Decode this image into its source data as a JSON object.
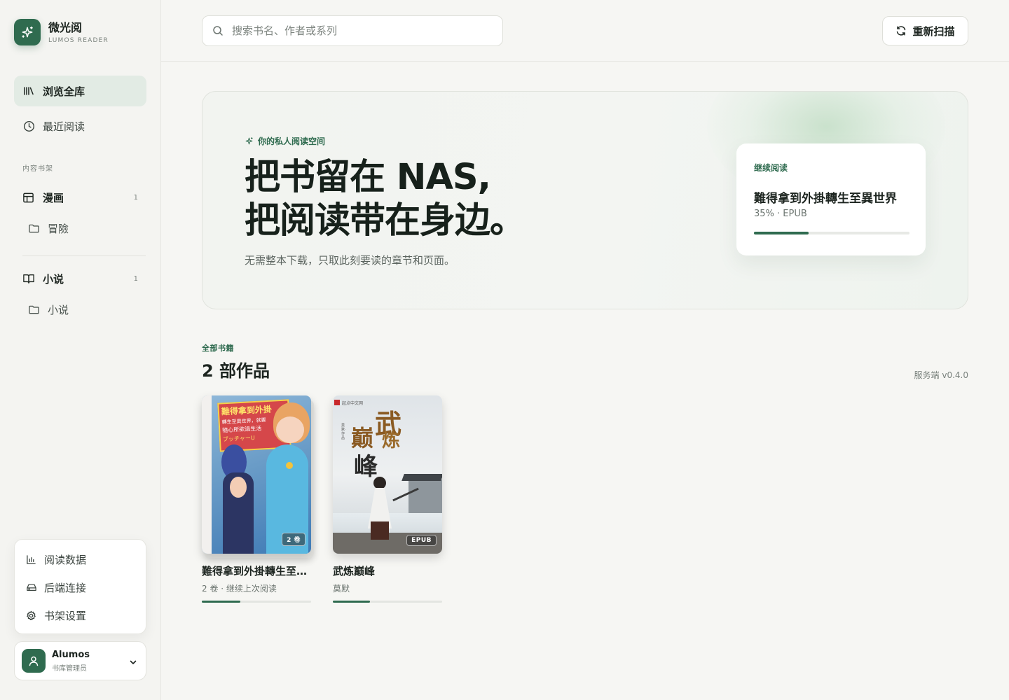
{
  "brand": {
    "title": "微光阅",
    "subtitle": "LUMOS READER"
  },
  "nav": [
    {
      "label": "浏览全库",
      "icon": "library-icon",
      "active": true
    },
    {
      "label": "最近阅读",
      "icon": "clock-icon",
      "active": false
    }
  ],
  "sidebar_section_label": "内容书架",
  "shelves": [
    {
      "label": "漫画",
      "count": "1",
      "icon": "layout-icon",
      "folders": [
        {
          "label": "冒險"
        }
      ]
    },
    {
      "label": "小说",
      "count": "1",
      "icon": "book-open-icon",
      "folders": [
        {
          "label": "小说"
        }
      ]
    }
  ],
  "menu": [
    {
      "label": "阅读数据",
      "icon": "bar-chart-icon"
    },
    {
      "label": "后端连接",
      "icon": "hard-drive-icon"
    },
    {
      "label": "书架设置",
      "icon": "gear-icon"
    }
  ],
  "user": {
    "name": "Alumos",
    "role": "书库管理员"
  },
  "search": {
    "placeholder": "搜索书名、作者或系列",
    "value": ""
  },
  "rescan_label": "重新扫描",
  "hero": {
    "eyebrow": "你的私人阅读空间",
    "title_line1": "把书留在 NAS,",
    "title_line2": "把阅读带在身边。",
    "description": "无需整本下载，只取此刻要读的章节和页面。"
  },
  "continue_reading": {
    "label": "继续阅读",
    "title": "難得拿到外掛轉生至異世界",
    "meta": "35% · EPUB",
    "progress": 0.35
  },
  "library": {
    "eyebrow": "全部书籍",
    "title": "2 部作品",
    "server_version": "服务端 v0.4.0"
  },
  "books": [
    {
      "title": "難得拿到外掛轉生至異世界",
      "meta": "2 卷 · 继续上次阅读",
      "badge": "2 卷",
      "progress": 0.35,
      "cover_text_1": "難得拿到外掛",
      "cover_text_2": "轉生至異世界，就要",
      "cover_text_3": "隨心所欲過生活",
      "cover_text_4": "ブッチャーU"
    },
    {
      "title": "武炼巅峰",
      "meta": "莫默",
      "badge": "EPUB",
      "progress": 0.34,
      "cover_text_1": "武",
      "cover_text_2": "炼",
      "cover_text_3": "巅",
      "cover_text_4": "峰",
      "cover_publisher": "起点中文网",
      "cover_author_vertical": "莫默·作品"
    }
  ],
  "colors": {
    "accent": "#2f6b4f",
    "accent_soft": "#e2ebe4",
    "background": "#f6f6f3"
  }
}
